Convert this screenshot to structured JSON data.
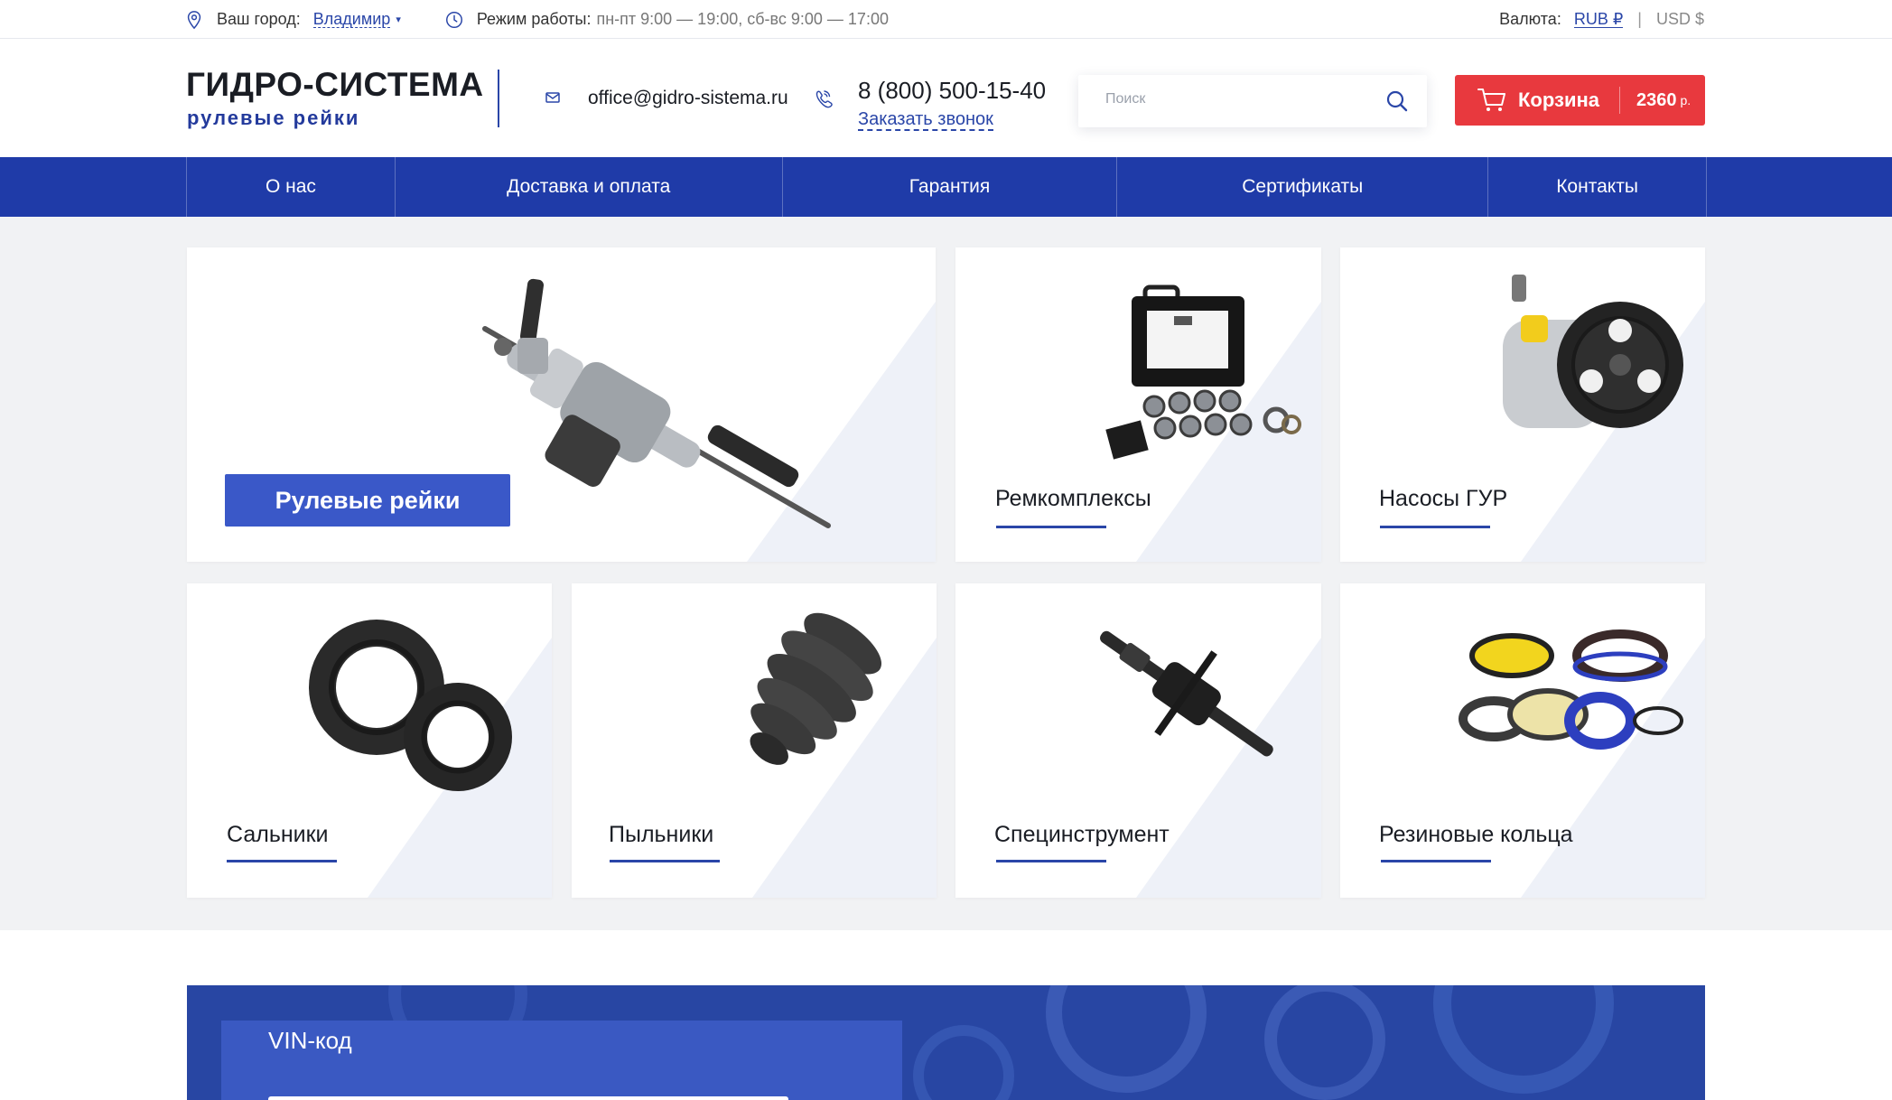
{
  "topbar": {
    "city_label": "Ваш город:",
    "city_value": "Владимир",
    "city_caret": "▾",
    "hours_label": "Режим работы:",
    "hours_value": "пн-пт 9:00 — 19:00, сб-вс 9:00 — 17:00",
    "currency_label": "Валюта:",
    "currency_rub": "RUB ₽",
    "currency_sep": "|",
    "currency_usd": "USD $",
    "icons": [
      "location-pin-icon",
      "clock-icon"
    ]
  },
  "header": {
    "logo_title": "ГИДРО-СИСТЕМА",
    "logo_subtitle": "рулевые рейки",
    "email": "office@gidro-sistema.ru",
    "phone": "8 (800) 500-15-40",
    "callback": "Заказать звонок",
    "search_placeholder": "Поиск",
    "cart_label": "Корзина",
    "cart_sum": "2360",
    "cart_currency": "р.",
    "icons": [
      "mail-icon",
      "phone-icon",
      "search-icon",
      "cart-icon"
    ]
  },
  "nav": {
    "items": [
      "О нас",
      "Доставка и оплата",
      "Гарантия",
      "Сертификаты",
      "Контакты"
    ]
  },
  "catalog": {
    "featured": "Рулевые рейки",
    "items": [
      "Ремкомплексы",
      "Насосы ГУР",
      "Сальники",
      "Пыльники",
      "Специнструмент",
      "Резиновые кольца"
    ]
  },
  "vin": {
    "title": "VIN-код"
  },
  "colors": {
    "brand_blue": "#1f3ba8",
    "accent_blue": "#2a46a8",
    "cart_red": "#e8393e",
    "page_bg": "#f1f2f4"
  }
}
